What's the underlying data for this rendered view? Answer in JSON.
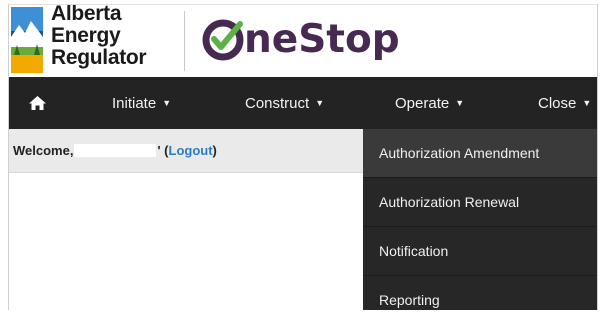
{
  "brand": {
    "org_lines": [
      "Alberta",
      "Energy",
      "Regulator"
    ],
    "app_name": "OneStop",
    "accent_color": "#472a52",
    "check_color": "#5cb247"
  },
  "nav": {
    "home_icon": "home-icon",
    "items": [
      {
        "label": "Initiate"
      },
      {
        "label": "Construct"
      },
      {
        "label": "Operate"
      },
      {
        "label": "Close"
      }
    ]
  },
  "welcome": {
    "greeting": "Welcome, ",
    "name_suffix": "'",
    "open_paren": " (",
    "logout": "Logout",
    "close_paren": ")"
  },
  "dropdown": {
    "items": [
      {
        "label": "Authorization Amendment",
        "highlighted": true
      },
      {
        "label": "Authorization Renewal"
      },
      {
        "label": "Notification"
      },
      {
        "label": "Reporting"
      }
    ]
  },
  "colors": {
    "navbar_bg": "#232323",
    "dropdown_bg": "#272727",
    "dropdown_hover_bg": "#3a3a3a",
    "welcome_bg": "#eaeaea",
    "link": "#2f7ac4"
  }
}
